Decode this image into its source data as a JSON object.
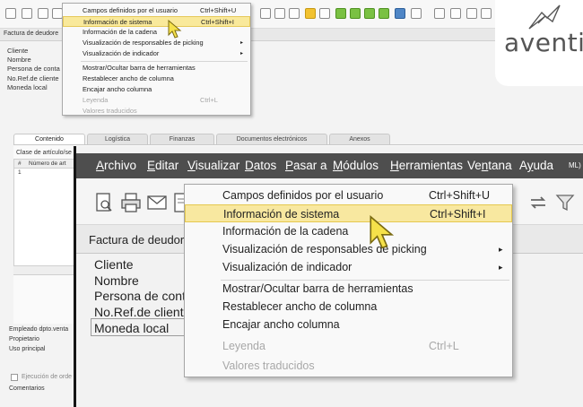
{
  "background_window": {
    "form_title": "Factura de deudore",
    "fields": [
      "Cliente",
      "Nombre",
      "Persona de conta",
      "No.Ref.de cliente",
      "Moneda local"
    ],
    "tabs": [
      "Contenido",
      "Logística",
      "Finanzas",
      "Documentos electrónicos",
      "Anexos"
    ],
    "class_label": "Clase de artículo/se",
    "grid_header_hash": "#",
    "grid_header_col": "Número de art",
    "grid_row_num": "1",
    "bottom_fields": [
      "Empleado dpto.venta",
      "Propietario",
      "Uso principal"
    ],
    "ejecucion_label": "Ejecución de orde",
    "comentarios_label": "Comentarios"
  },
  "small_menu": {
    "items": [
      {
        "label": "Campos definidos por el usuario",
        "shortcut": "Ctrl+Shift+U"
      },
      {
        "label": "Información de sistema",
        "shortcut": "Ctrl+Shift+I"
      },
      {
        "label": "Información de la cadena",
        "shortcut": ""
      },
      {
        "label": "Visualización de responsables de picking",
        "shortcut": ""
      },
      {
        "label": "Visualización de indicador",
        "shortcut": ""
      },
      {
        "label": "Mostrar/Ocultar barra de herramientas",
        "shortcut": ""
      },
      {
        "label": "Restablecer ancho de columna",
        "shortcut": ""
      },
      {
        "label": "Encajar ancho columna",
        "shortcut": ""
      },
      {
        "label": "Leyenda",
        "shortcut": "Ctrl+L"
      },
      {
        "label": "Valores traducidos",
        "shortcut": ""
      }
    ],
    "submenu_arrow": "▸"
  },
  "logo": {
    "text": "aventi",
    "color": "#555555"
  },
  "zoom": {
    "menubar": [
      "Archivo",
      "Editar",
      "Visualizar",
      "Datos",
      "Pasar a",
      "Módulos",
      "Herramientas",
      "Ventana",
      "Ayuda"
    ],
    "menubar_underline": [
      "A",
      "E",
      "V",
      "D",
      "P",
      "M",
      "H",
      "n",
      "y"
    ],
    "right_fragment": "ML)",
    "form_title": "Factura de deudore",
    "fields": [
      "Cliente",
      "Nombre",
      "Persona de conta",
      "No.Ref.de cliente",
      "Moneda local"
    ],
    "big_menu": {
      "items": [
        {
          "label": "Campos definidos por el usuario",
          "shortcut": "Ctrl+Shift+U"
        },
        {
          "label": "Información de sistema",
          "shortcut": "Ctrl+Shift+I"
        },
        {
          "label": "Información de la cadena",
          "shortcut": ""
        },
        {
          "label": "Visualización de responsables de picking",
          "shortcut": ""
        },
        {
          "label": "Visualización de indicador",
          "shortcut": ""
        },
        {
          "label": "Mostrar/Ocultar barra de herramientas",
          "shortcut": ""
        },
        {
          "label": "Restablecer ancho de columna",
          "shortcut": ""
        },
        {
          "label": "Encajar ancho columna",
          "shortcut": ""
        },
        {
          "label": "Leyenda",
          "shortcut": "Ctrl+L"
        },
        {
          "label": "Valores traducidos",
          "shortcut": ""
        }
      ],
      "submenu_arrow": "▸"
    }
  },
  "colors": {
    "highlight": "#f8e8a0",
    "menubar": "#4e4e4e",
    "cursor": "#f5e14a"
  },
  "icons": [
    "preview-icon",
    "print-icon",
    "email-icon",
    "document-icon",
    "refresh-icon",
    "filter-icon",
    "mouse-cursor-icon"
  ]
}
